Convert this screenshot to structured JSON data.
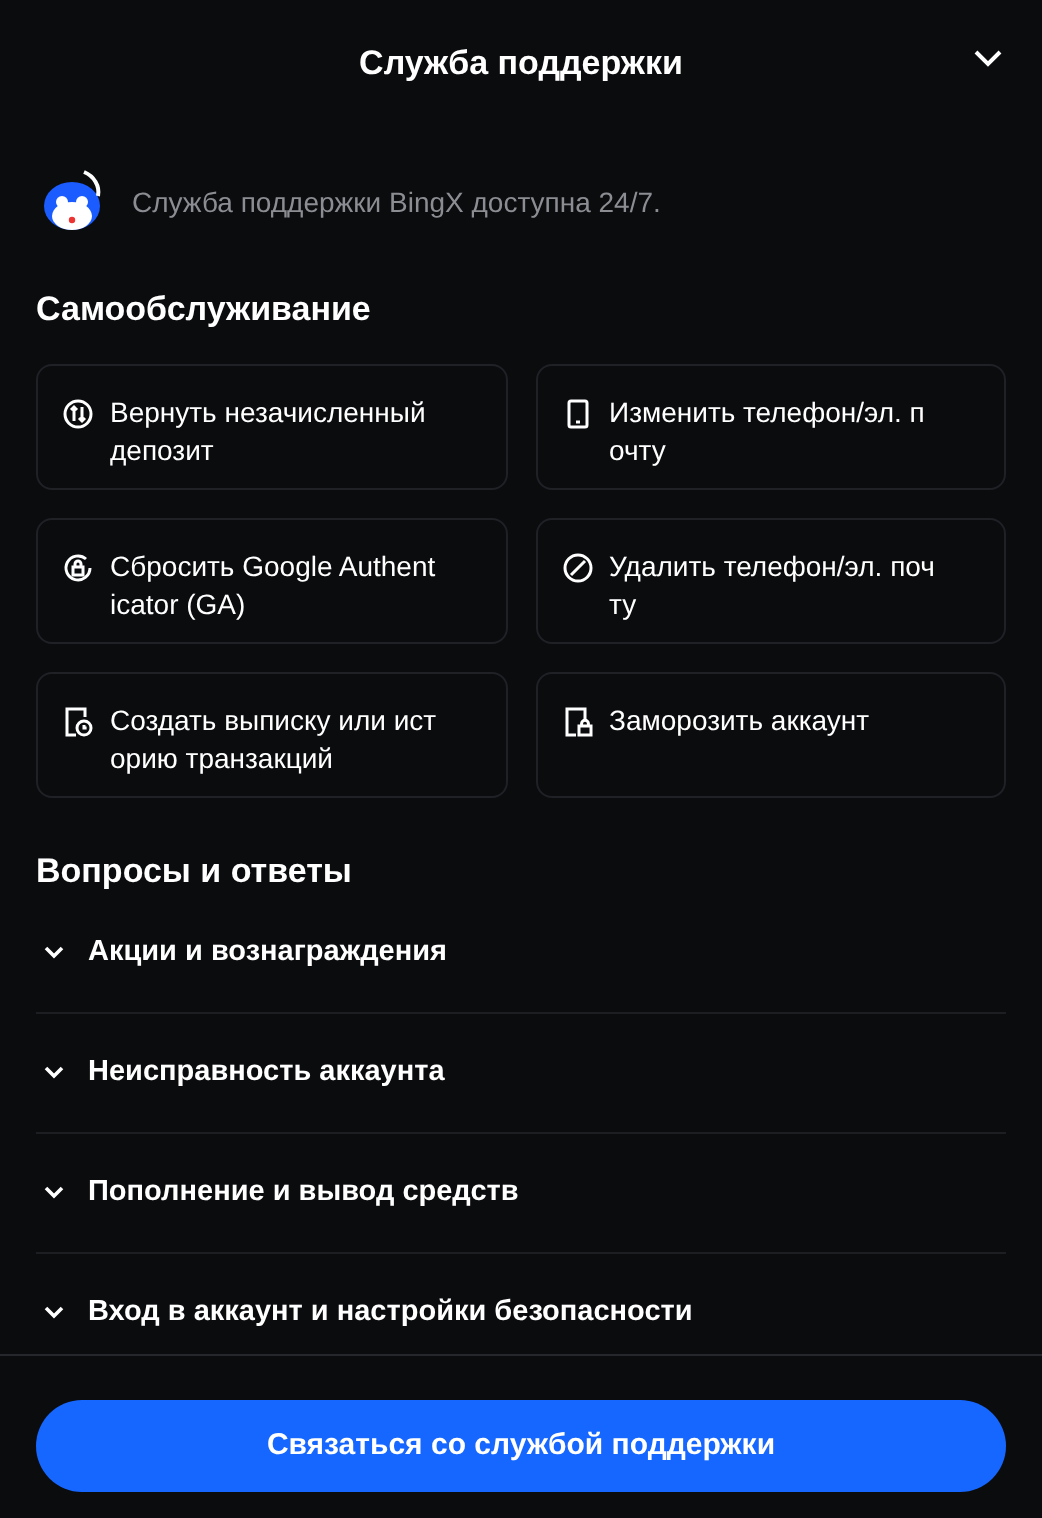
{
  "header": {
    "title": "Служба поддержки"
  },
  "intro": {
    "text": "Служба поддержки BingX доступна 24/7."
  },
  "self_service": {
    "title": "Самообслуживание",
    "items": [
      {
        "kind": "refund",
        "label": "Вернуть незачисленный депозит"
      },
      {
        "kind": "phone",
        "label": "Изменить телефон/эл. почту"
      },
      {
        "kind": "reset",
        "label": "Сбросить Google Authenticator (GA)"
      },
      {
        "kind": "remove",
        "label": "Удалить телефон/эл. почту"
      },
      {
        "kind": "statement",
        "label": "Создать выписку или историю транзакций"
      },
      {
        "kind": "freeze",
        "label": "Заморозить аккаунт"
      }
    ]
  },
  "faq": {
    "title": "Вопросы и ответы",
    "items": [
      {
        "label": "Акции и вознаграждения",
        "expanded": false
      },
      {
        "label": "Неисправность аккаунта",
        "expanded": false
      },
      {
        "label": "Пополнение и вывод средств",
        "expanded": false
      },
      {
        "label": "Вход в аккаунт и настройки безопасности",
        "expanded": false
      }
    ]
  },
  "footer": {
    "button": "Связаться со службой поддержки"
  }
}
